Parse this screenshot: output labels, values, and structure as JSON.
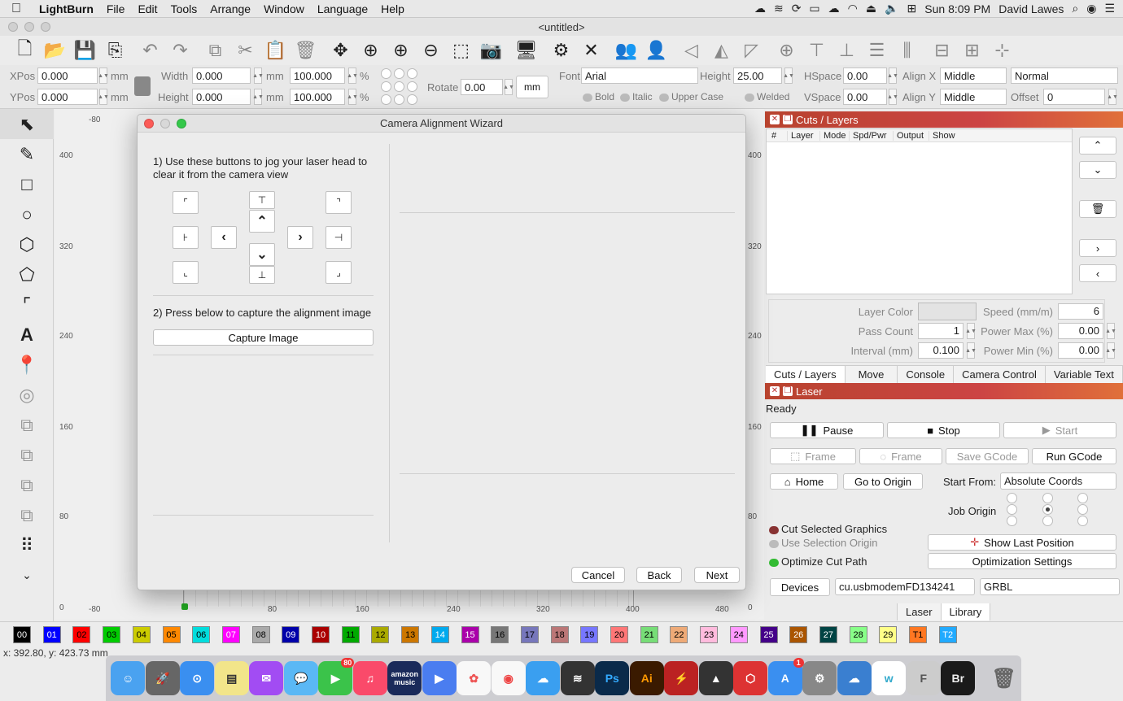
{
  "menubar": {
    "app": "LightBurn",
    "items": [
      "File",
      "Edit",
      "Tools",
      "Arrange",
      "Window",
      "Language",
      "Help"
    ],
    "clock": "Sun 8:09 PM",
    "user": "David Lawes"
  },
  "window": {
    "title": "<untitled>"
  },
  "props": {
    "xpos_label": "XPos",
    "xpos": "0.000",
    "ypos_label": "YPos",
    "ypos": "0.000",
    "unit_mm": "mm",
    "width_label": "Width",
    "width": "0.000",
    "height_label": "Height",
    "height": "0.000",
    "scale_w": "100.000",
    "scale_h": "100.000",
    "pct": "%",
    "rotate_label": "Rotate",
    "rotate": "0.00",
    "mm_button": "mm",
    "font_label": "Font",
    "font": "Arial",
    "fheight_label": "Height",
    "fheight": "25.00",
    "hspace_label": "HSpace",
    "hspace": "0.00",
    "vspace_label": "VSpace",
    "vspace": "0.00",
    "alignx_label": "Align X",
    "alignx": "Middle",
    "aligny_label": "Align Y",
    "aligny": "Middle",
    "mode": "Normal",
    "offset_label": "Offset",
    "offset": "0",
    "bold": "Bold",
    "italic": "Italic",
    "upper": "Upper Case",
    "welded": "Welded"
  },
  "ruler": {
    "left": [
      "400",
      "320",
      "240",
      "160",
      "80",
      "0"
    ],
    "top_first": "-80",
    "bottom": [
      "-80",
      "80",
      "160",
      "240",
      "320",
      "400",
      "480"
    ],
    "right": [
      "400",
      "320",
      "240",
      "160",
      "80",
      "0"
    ]
  },
  "dialog": {
    "title": "Camera Alignment Wizard",
    "step1": "1) Use these buttons to jog your laser head to clear it from the camera view",
    "step2": "2) Press below to capture the alignment image",
    "capture": "Capture Image",
    "cancel": "Cancel",
    "back": "Back",
    "next": "Next"
  },
  "cuts": {
    "title": "Cuts / Layers",
    "columns": [
      "#",
      "Layer",
      "Mode",
      "Spd/Pwr",
      "Output",
      "Show"
    ],
    "layer_color_label": "Layer Color",
    "speed_label": "Speed (mm/m)",
    "speed": "6",
    "pass_label": "Pass Count",
    "pass": "1",
    "pmax_label": "Power Max (%)",
    "pmax": "0.00",
    "interval_label": "Interval (mm)",
    "interval": "0.100",
    "pmin_label": "Power Min (%)",
    "pmin": "0.00",
    "tabs": [
      "Cuts / Layers",
      "Move",
      "Console",
      "Camera Control",
      "Variable Text"
    ]
  },
  "laser": {
    "title": "Laser",
    "status": "Ready",
    "pause": "Pause",
    "stop": "Stop",
    "start": "Start",
    "frame1": "Frame",
    "frame2": "Frame",
    "save_gcode": "Save GCode",
    "run_gcode": "Run GCode",
    "home": "Home",
    "go_origin": "Go to Origin",
    "start_from_label": "Start From:",
    "start_from": "Absolute Coords",
    "job_origin": "Job Origin",
    "cut_selected": "Cut Selected Graphics",
    "use_selection": "Use Selection Origin",
    "optimize": "Optimize Cut Path",
    "show_last": "Show Last Position",
    "opt_settings": "Optimization Settings",
    "devices": "Devices",
    "port": "cu.usbmodemFD134241",
    "controller": "GRBL",
    "tabs": [
      "Laser",
      "Library"
    ]
  },
  "palette": [
    {
      "n": "00",
      "c": "#000000",
      "t": "#ffffff"
    },
    {
      "n": "01",
      "c": "#0000ff",
      "t": "#ffffff"
    },
    {
      "n": "02",
      "c": "#ff0000",
      "t": "#000000"
    },
    {
      "n": "03",
      "c": "#00cc00",
      "t": "#000000"
    },
    {
      "n": "04",
      "c": "#cccc00",
      "t": "#000000"
    },
    {
      "n": "05",
      "c": "#ff8800",
      "t": "#000000"
    },
    {
      "n": "06",
      "c": "#00dddd",
      "t": "#000000"
    },
    {
      "n": "07",
      "c": "#ff00ff",
      "t": "#ffffff"
    },
    {
      "n": "08",
      "c": "#aaaaaa",
      "t": "#000000"
    },
    {
      "n": "09",
      "c": "#0000aa",
      "t": "#ffffff"
    },
    {
      "n": "10",
      "c": "#aa0000",
      "t": "#ffffff"
    },
    {
      "n": "11",
      "c": "#00aa00",
      "t": "#000000"
    },
    {
      "n": "12",
      "c": "#aaaa00",
      "t": "#000000"
    },
    {
      "n": "13",
      "c": "#cc7700",
      "t": "#000000"
    },
    {
      "n": "14",
      "c": "#00aaee",
      "t": "#ffffff"
    },
    {
      "n": "15",
      "c": "#aa00aa",
      "t": "#ffffff"
    },
    {
      "n": "16",
      "c": "#777777",
      "t": "#000000"
    },
    {
      "n": "17",
      "c": "#7777bb",
      "t": "#000000"
    },
    {
      "n": "18",
      "c": "#bb7777",
      "t": "#000000"
    },
    {
      "n": "19",
      "c": "#7777ff",
      "t": "#000000"
    },
    {
      "n": "20",
      "c": "#ff7777",
      "t": "#000000"
    },
    {
      "n": "21",
      "c": "#77dd77",
      "t": "#000000"
    },
    {
      "n": "22",
      "c": "#eeaa77",
      "t": "#000000"
    },
    {
      "n": "23",
      "c": "#ffbbdd",
      "t": "#000000"
    },
    {
      "n": "24",
      "c": "#ff99ff",
      "t": "#000000"
    },
    {
      "n": "25",
      "c": "#440088",
      "t": "#ffffff"
    },
    {
      "n": "26",
      "c": "#aa5500",
      "t": "#ffffff"
    },
    {
      "n": "27",
      "c": "#004444",
      "t": "#ffffff"
    },
    {
      "n": "28",
      "c": "#88ff88",
      "t": "#000000"
    },
    {
      "n": "29",
      "c": "#ffff88",
      "t": "#000000"
    },
    {
      "n": "T1",
      "c": "#ff7722",
      "t": "#000000"
    },
    {
      "n": "T2",
      "c": "#22aaff",
      "t": "#ffffff"
    }
  ],
  "status": "x: 392.80, y: 423.73 mm",
  "dock_badges": {
    "facetime": "80",
    "appstore": "1"
  },
  "dock_labels": {
    "amazon": "amazon music",
    "ps": "Ps",
    "ai": "Ai",
    "br": "Br",
    "w": "w",
    "f": "F"
  }
}
